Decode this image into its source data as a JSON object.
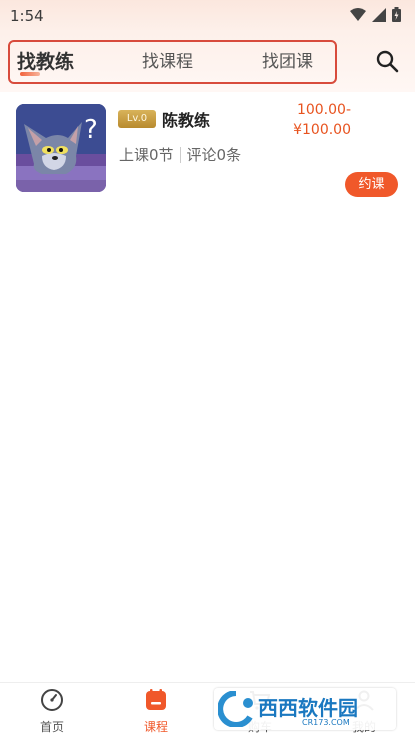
{
  "status_bar": {
    "time": "1:54"
  },
  "tabs": [
    {
      "label": "找教练",
      "active": true
    },
    {
      "label": "找课程",
      "active": false
    },
    {
      "label": "找团课",
      "active": false
    }
  ],
  "coach_card": {
    "level": "Lv.0",
    "name": "陈教练",
    "price_min": "100.00-",
    "price_max": "¥100.00",
    "lessons": "上课0节",
    "reviews": "评论0条",
    "book_label": "约课"
  },
  "bottom_nav": [
    {
      "label": "首页",
      "icon": "clock-icon",
      "active": false
    },
    {
      "label": "课程",
      "icon": "calendar-icon",
      "active": true
    },
    {
      "label": "购车",
      "icon": "cart-icon",
      "active": false
    },
    {
      "label": "我的",
      "icon": "user-icon",
      "active": false
    }
  ],
  "watermark": {
    "brand": "西西软件园",
    "domain": "CR173.COM"
  },
  "colors": {
    "accent": "#f0582a",
    "price": "#e8531f",
    "tab_frame": "#d84b3c",
    "header_bg": "#fdf0ea"
  }
}
